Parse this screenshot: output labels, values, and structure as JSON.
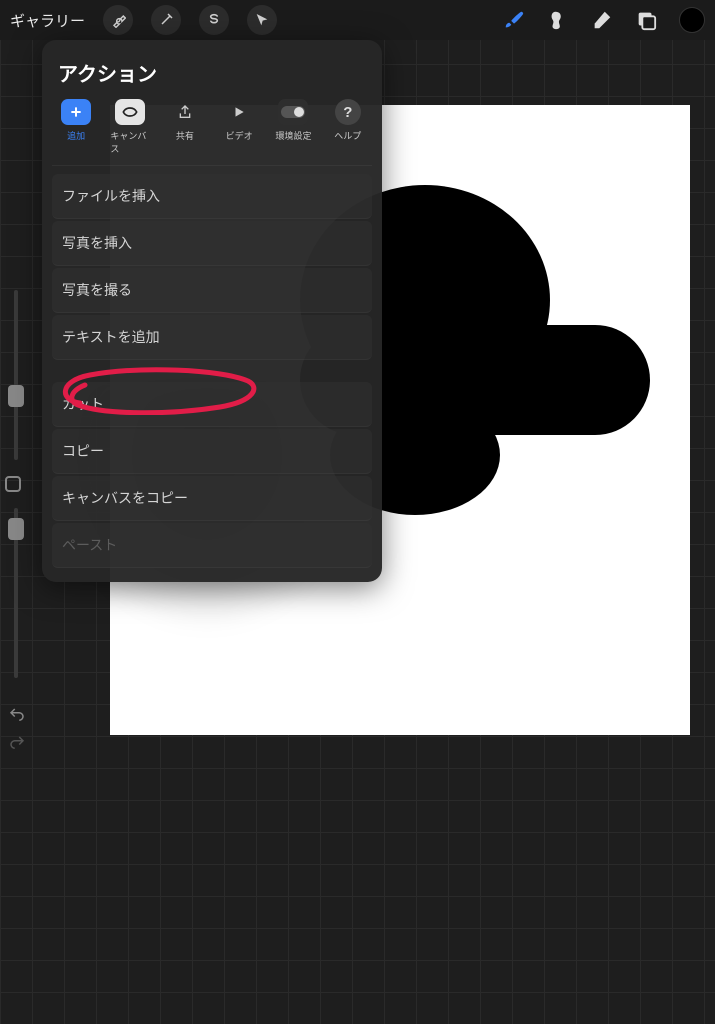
{
  "topbar": {
    "gallery_label": "ギャラリー"
  },
  "actions": {
    "title": "アクション",
    "tabs": {
      "add": "追加",
      "canvas": "キャンバス",
      "share": "共有",
      "video": "ビデオ",
      "prefs": "環境設定",
      "help": "ヘルプ"
    },
    "items": {
      "insert_file": "ファイルを挿入",
      "insert_photo": "写真を挿入",
      "take_photo": "写真を撮る",
      "add_text": "テキストを追加",
      "cut": "カット",
      "copy": "コピー",
      "copy_canvas": "キャンバスをコピー",
      "paste": "ペースト"
    }
  },
  "colors": {
    "accent": "#3b82f6",
    "annotation": "#e11d48"
  }
}
